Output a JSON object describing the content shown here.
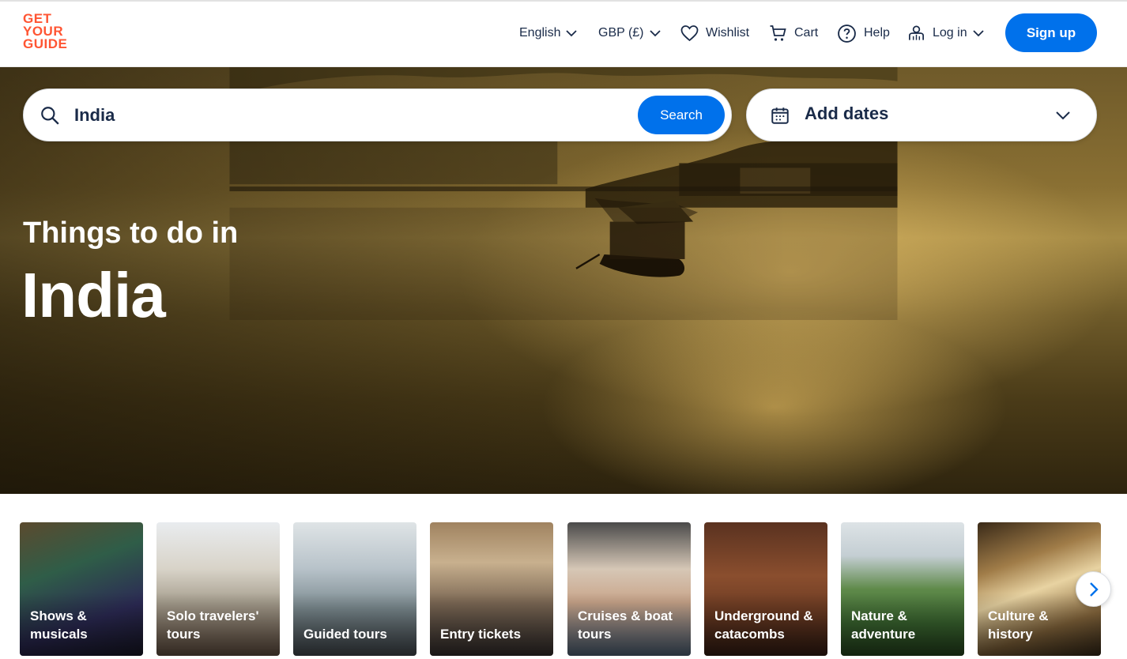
{
  "brand": {
    "logo_lines": [
      "GET",
      "YOUR",
      "GUIDE"
    ],
    "color": "#ff5533"
  },
  "nav": {
    "language": "English",
    "currency": "GBP (£)",
    "wishlist": "Wishlist",
    "cart": "Cart",
    "help": "Help",
    "login": "Log in",
    "signup": "Sign up"
  },
  "search": {
    "value": "India",
    "button": "Search"
  },
  "dates": {
    "label": "Add dates"
  },
  "hero": {
    "subtitle": "Things to do in",
    "title": "India"
  },
  "categories": [
    {
      "label": "Shows & musicals",
      "icon": "photo"
    },
    {
      "label": "Solo travelers' tours",
      "icon": "photo"
    },
    {
      "label": "Guided tours",
      "icon": "photo"
    },
    {
      "label": "Entry tickets",
      "icon": "photo"
    },
    {
      "label": "Cruises & boat tours",
      "icon": "photo"
    },
    {
      "label": "Underground & catacombs",
      "icon": "photo"
    },
    {
      "label": "Nature & adventure",
      "icon": "photo"
    },
    {
      "label": "Culture & history",
      "icon": "photo"
    }
  ],
  "colors": {
    "accent": "#0071eb",
    "text": "#1a2b49"
  }
}
